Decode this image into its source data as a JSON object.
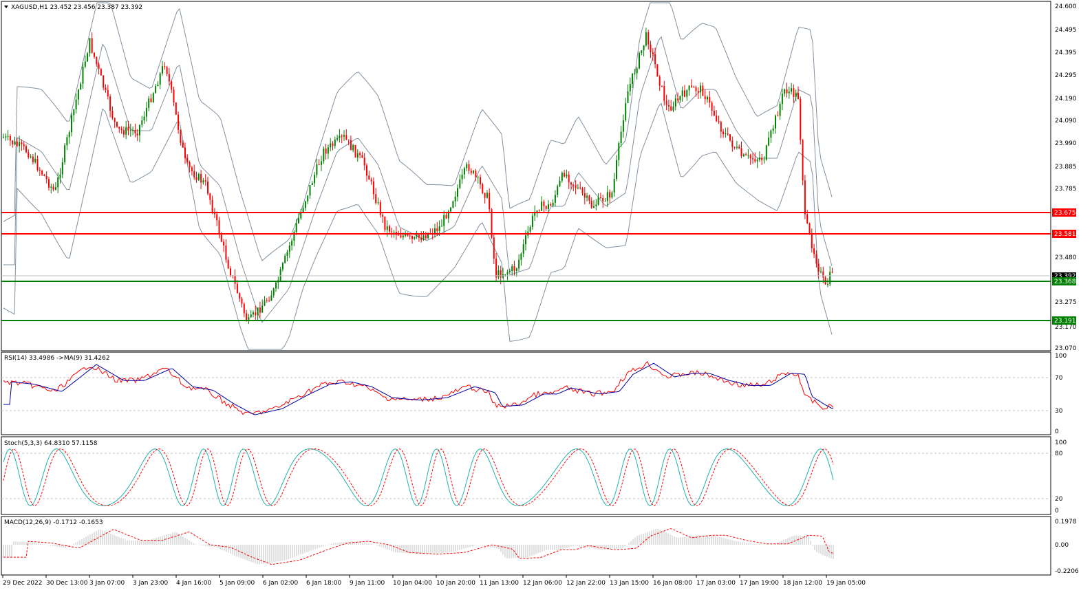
{
  "main": {
    "symbol_info": "XAGUSD,H1  23.452 23.456 23.387 23.392",
    "price_axis": [
      "24.600",
      "24.495",
      "24.395",
      "24.295",
      "24.190",
      "24.090",
      "23.990",
      "23.885",
      "23.785",
      "23.480",
      "23.275",
      "23.170",
      "23.070"
    ],
    "current_price": "23.392",
    "levels": [
      {
        "label": "23.675",
        "color": "#ff0000"
      },
      {
        "label": "23.581",
        "color": "#ff0000"
      },
      {
        "label": "23.368",
        "color": "#008000"
      },
      {
        "label": "23.191",
        "color": "#008000"
      }
    ]
  },
  "rsi": {
    "title": "RSI(14) 33.4986  ->MA(9) 31.4262",
    "axis": [
      "100",
      "70",
      "30",
      "0"
    ]
  },
  "stoch": {
    "title": "Stoch(5,3,3) 64.8310 57.1158",
    "axis": [
      "100",
      "80",
      "20",
      "0"
    ]
  },
  "macd": {
    "title": "MACD(12,26,9) -0.1712 -0.1653",
    "axis": [
      "0.1978",
      "0.00",
      "-0.2206"
    ]
  },
  "time_axis": [
    "29 Dec 2022",
    "30 Dec 13:00",
    "3 Jan 07:00",
    "3 Jan 23:00",
    "4 Jan 16:00",
    "5 Jan 09:00",
    "6 Jan 02:00",
    "6 Jan 18:00",
    "9 Jan 11:00",
    "10 Jan 04:00",
    "10 Jan 20:00",
    "11 Jan 13:00",
    "12 Jan 06:00",
    "12 Jan 22:00",
    "13 Jan 15:00",
    "16 Jan 08:00",
    "17 Jan 03:00",
    "17 Jan 19:00",
    "18 Jan 12:00",
    "19 Jan 05:00"
  ],
  "colors": {
    "bull": "#008000",
    "bear": "#ff0000",
    "bands": "#8090a0",
    "rsi_line": "#ff0000",
    "rsi_ma": "#0000a0",
    "stoch_main": "#20b2aa",
    "stoch_signal": "#ff0000",
    "macd_hist": "#c0c0c0",
    "macd_signal": "#ff0000"
  },
  "icons": {
    "collapse": "triangle-down-icon"
  }
}
